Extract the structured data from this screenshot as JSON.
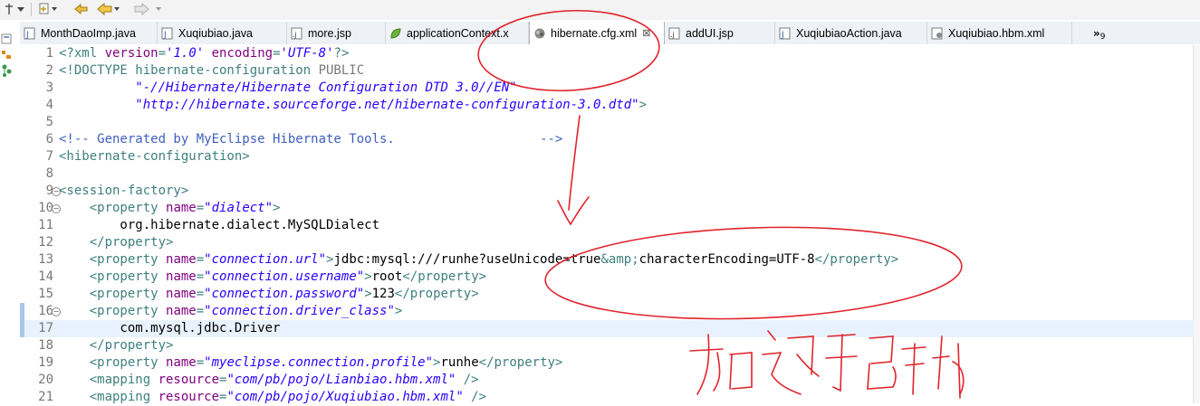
{
  "colors": {
    "tag": "#3f7f7f",
    "attr_name": "#7f007f",
    "attr_value": "#2a00ff",
    "comment": "#3f5fbf",
    "text": "#000000",
    "annotation": "#e0242c"
  },
  "toolbar": {
    "icons": [
      "pin-icon",
      "dropdown-icon",
      "last-edit-icon",
      "back-icon",
      "forward-icon"
    ]
  },
  "tabs": [
    {
      "label": "MonthDaoImp.java",
      "icon": "java-file-icon",
      "active": false
    },
    {
      "label": "Xuqiubiao.java",
      "icon": "java-file-icon",
      "active": false
    },
    {
      "label": "more.jsp",
      "icon": "jsp-file-icon",
      "active": false
    },
    {
      "label": "applicationContext.x",
      "icon": "spring-leaf-icon",
      "active": false
    },
    {
      "label": "hibernate.cfg.xml",
      "icon": "hibernate-icon",
      "active": true
    },
    {
      "label": "addUI.jsp",
      "icon": "jsp-file-icon",
      "active": false
    },
    {
      "label": "XuqiubiaoAction.java",
      "icon": "java-file-icon",
      "active": false
    },
    {
      "label": "Xuqiubiao.hbm.xml",
      "icon": "hbm-file-icon",
      "active": false
    }
  ],
  "tabs_overflow": {
    "glyph": "»",
    "count": "9"
  },
  "editor": {
    "current_line": 17,
    "lines": [
      {
        "n": "1",
        "segs": [
          [
            "t",
            "<?"
          ],
          [
            "t",
            "xml "
          ],
          [
            "a",
            "version"
          ],
          [
            "t",
            "="
          ],
          [
            "v",
            "'1.0'"
          ],
          [
            "t",
            " "
          ],
          [
            "a",
            "encoding"
          ],
          [
            "t",
            "="
          ],
          [
            "v",
            "'UTF-8'"
          ],
          [
            "t",
            "?>"
          ]
        ]
      },
      {
        "n": "2",
        "segs": [
          [
            "t",
            "<!DOCTYPE hibernate-configuration "
          ],
          [
            "p",
            "PUBLIC"
          ]
        ]
      },
      {
        "n": "3",
        "segs": [
          [
            "x",
            "          "
          ],
          [
            "v",
            "\"-//Hibernate/Hibernate Configuration DTD 3.0//EN\""
          ]
        ]
      },
      {
        "n": "4",
        "segs": [
          [
            "x",
            "          "
          ],
          [
            "v",
            "\"http://hibernate.sourceforge.net/hibernate-configuration-3.0.dtd\""
          ],
          [
            "t",
            ">"
          ]
        ]
      },
      {
        "n": "5",
        "segs": []
      },
      {
        "n": "6",
        "segs": [
          [
            "c",
            "<!-- Generated by MyEclipse Hibernate Tools.                   -->"
          ]
        ]
      },
      {
        "n": "7",
        "segs": [
          [
            "t",
            "<hibernate-configuration>"
          ]
        ]
      },
      {
        "n": "8",
        "segs": []
      },
      {
        "n": "9",
        "fold": true,
        "segs": [
          [
            "t",
            "<session-factory>"
          ]
        ]
      },
      {
        "n": "10",
        "fold": true,
        "segs": [
          [
            "x",
            "    "
          ],
          [
            "t",
            "<property "
          ],
          [
            "a",
            "name"
          ],
          [
            "t",
            "="
          ],
          [
            "v",
            "\"dialect\""
          ],
          [
            "t",
            ">"
          ]
        ]
      },
      {
        "n": "11",
        "segs": [
          [
            "x",
            "        org.hibernate.dialect.MySQLDialect"
          ]
        ]
      },
      {
        "n": "12",
        "segs": [
          [
            "x",
            "    "
          ],
          [
            "t",
            "</property>"
          ]
        ]
      },
      {
        "n": "13",
        "segs": [
          [
            "x",
            "    "
          ],
          [
            "t",
            "<property "
          ],
          [
            "a",
            "name"
          ],
          [
            "t",
            "="
          ],
          [
            "v",
            "\"connection.url\""
          ],
          [
            "t",
            ">"
          ],
          [
            "x",
            "jdbc:mysql:///runhe?useUnicode=true"
          ],
          [
            "t",
            "&amp;"
          ],
          [
            "x",
            "characterEncoding=UTF-8"
          ],
          [
            "t",
            "</property>"
          ]
        ]
      },
      {
        "n": "14",
        "segs": [
          [
            "x",
            "    "
          ],
          [
            "t",
            "<property "
          ],
          [
            "a",
            "name"
          ],
          [
            "t",
            "="
          ],
          [
            "v",
            "\"connection.username\""
          ],
          [
            "t",
            ">"
          ],
          [
            "x",
            "root"
          ],
          [
            "t",
            "</property>"
          ]
        ]
      },
      {
        "n": "15",
        "segs": [
          [
            "x",
            "    "
          ],
          [
            "t",
            "<property "
          ],
          [
            "a",
            "name"
          ],
          [
            "t",
            "="
          ],
          [
            "v",
            "\"connection.password\""
          ],
          [
            "t",
            ">"
          ],
          [
            "x",
            "123"
          ],
          [
            "t",
            "</property>"
          ]
        ]
      },
      {
        "n": "16",
        "fold": true,
        "marker": true,
        "segs": [
          [
            "x",
            "    "
          ],
          [
            "t",
            "<property "
          ],
          [
            "a",
            "name"
          ],
          [
            "t",
            "="
          ],
          [
            "v",
            "\"connection.driver_class\""
          ],
          [
            "t",
            ">"
          ]
        ]
      },
      {
        "n": "17",
        "marker": true,
        "segs": [
          [
            "x",
            "        com.mysql.jdbc.Driver"
          ]
        ]
      },
      {
        "n": "18",
        "segs": [
          [
            "x",
            "    "
          ],
          [
            "t",
            "</property>"
          ]
        ]
      },
      {
        "n": "19",
        "segs": [
          [
            "x",
            "    "
          ],
          [
            "t",
            "<property "
          ],
          [
            "a",
            "name"
          ],
          [
            "t",
            "="
          ],
          [
            "v",
            "\"myeclipse.connection.profile\""
          ],
          [
            "t",
            ">"
          ],
          [
            "x",
            "runhe"
          ],
          [
            "t",
            "</property>"
          ]
        ]
      },
      {
        "n": "20",
        "segs": [
          [
            "x",
            "    "
          ],
          [
            "t",
            "<mapping "
          ],
          [
            "a",
            "resource"
          ],
          [
            "t",
            "="
          ],
          [
            "v",
            "\"com/pb/pojo/Lianbiao.hbm.xml\""
          ],
          [
            "t",
            " />"
          ]
        ]
      },
      {
        "n": "21",
        "segs": [
          [
            "x",
            "    "
          ],
          [
            "t",
            "<mapping "
          ],
          [
            "a",
            "resource"
          ],
          [
            "t",
            "="
          ],
          [
            "v",
            "\"com/pb/pojo/Xuqiubiao.hbm.xml\""
          ],
          [
            "t",
            " />"
          ]
        ]
      }
    ]
  }
}
